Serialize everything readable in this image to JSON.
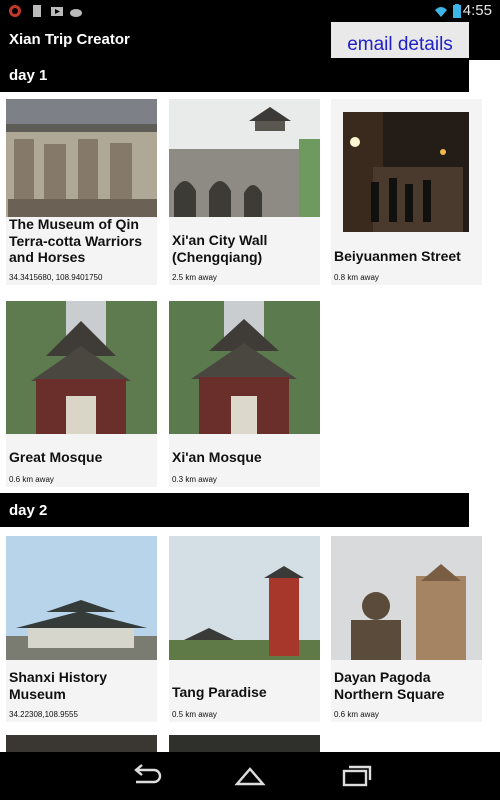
{
  "status": {
    "time": "4:55"
  },
  "app": {
    "title": "Xian Trip Creator",
    "email_label": "email details"
  },
  "days": [
    {
      "label": "day 1",
      "places": [
        {
          "name": "The Museum of Qin Terra-cotta Warriors and Horses",
          "distance": "34.3415680, 108.9401750"
        },
        {
          "name": "Xi'an City Wall (Chengqiang)",
          "distance": "2.5 km away"
        },
        {
          "name": "Beiyuanmen Street",
          "distance": "0.8 km away"
        },
        {
          "name": "Great Mosque",
          "distance": "0.6 km away"
        },
        {
          "name": "Xi'an Mosque",
          "distance": "0.3 km away"
        }
      ]
    },
    {
      "label": "day 2",
      "places": [
        {
          "name": "Shanxi History Museum",
          "distance": "34.22308,108.9555"
        },
        {
          "name": "Tang Paradise",
          "distance": "0.5 km away"
        },
        {
          "name": "Dayan Pagoda Northern Square",
          "distance": "0.6 km away"
        }
      ]
    }
  ]
}
